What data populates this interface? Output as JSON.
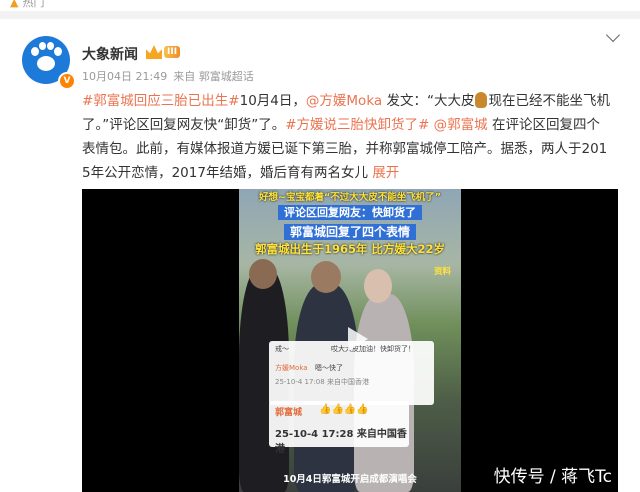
{
  "top": {
    "hot_label": "热门"
  },
  "post": {
    "author": "大象新闻",
    "vip_level": "III",
    "verified_badge": "V",
    "timestamp": "10月04日 21:49",
    "source": "来自 郭富城超话",
    "content": {
      "tag1": "#郭富城回应三胎已出生#",
      "t1": "10月4日，",
      "mention1": "@方媛Moka",
      "t2": " 发文：“大大皮",
      "t3": "现在已经不能坐飞机了。”评论区回复网友快“卸货”了。",
      "tag2": "#方媛说三胎快卸货了#",
      "t4": " ",
      "mention2": "@郭富城",
      "t5": " 在评论区回复四个表情包。此前，有媒体报道方媛已诞下第三胎，并称郭富城停工陪产。据悉，两人于2015年公开恋情，2017年结婚，婚后育有两名女儿",
      "expand": "展开"
    },
    "video": {
      "cap1": "好想~宝宝都着“不过大大皮不能坐飞机了”",
      "cap2": "评论区回复网友：快卸货了",
      "cap3": "郭富城回复了四个表情",
      "cap4": "郭富城出生于1965年 比方媛大22岁",
      "wm_small": "资料",
      "comment_line1": "戒～",
      "comment_line2": "哎大大皮加油！快卸货了！",
      "comment_line3": "方媛Moka",
      "comment_line4": "嗯～快了",
      "comment_line5": "25-10-4 17:08 来自中国香港",
      "reply_name": "郭富城",
      "reply_emoji": "👍👍👍👍",
      "reply_meta": "25-10-4 17:28 来自中国香港",
      "bottom_caption": "10月4日郭富城开启成都演唱会",
      "source_watermark": "快传号 / 蒋飞Tc"
    }
  },
  "colors": {
    "accent": "#eb7350",
    "brand_blue": "#1e7ad8",
    "vip_orange": "#f5a623"
  }
}
